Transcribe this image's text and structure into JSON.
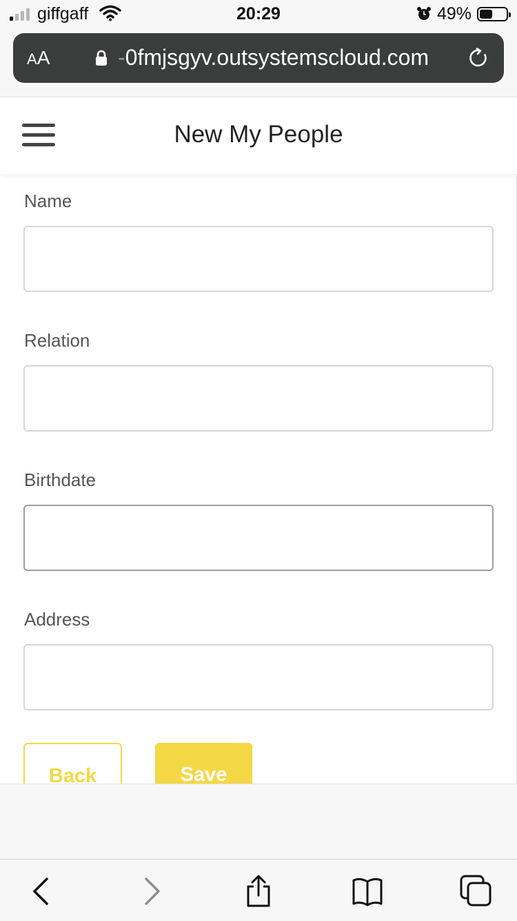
{
  "status_bar": {
    "carrier": "giffgaff",
    "time": "20:29",
    "battery_percent": "49%",
    "signal_bars_active": 1,
    "signal_bars_total": 4,
    "battery_level": 0.49,
    "icons": [
      "signal-icon",
      "wifi-icon",
      "alarm-icon",
      "battery-icon"
    ]
  },
  "browser": {
    "text_size_label_small": "A",
    "text_size_label_large": "A",
    "url_prefix": "-",
    "url": "0fmjsgyv.outsystemscloud.com",
    "icons": [
      "lock-icon",
      "reload-icon"
    ]
  },
  "header": {
    "title": "New My People",
    "menu_icon": "hamburger-menu-icon"
  },
  "form": {
    "fields": [
      {
        "label": "Name",
        "value": "",
        "placeholder": ""
      },
      {
        "label": "Relation",
        "value": "",
        "placeholder": ""
      },
      {
        "label": "Birthdate",
        "value": "",
        "placeholder": ""
      },
      {
        "label": "Address",
        "value": "",
        "placeholder": ""
      }
    ],
    "back_label": "Back",
    "save_label": "Save"
  },
  "toolbar": {
    "icons": [
      "back-arrow-icon",
      "forward-arrow-icon",
      "share-icon",
      "bookmarks-icon",
      "tabs-icon"
    ]
  },
  "colors": {
    "accent": "#f4d845",
    "url_bar": "#3b3d3c",
    "label_text": "#555555"
  }
}
